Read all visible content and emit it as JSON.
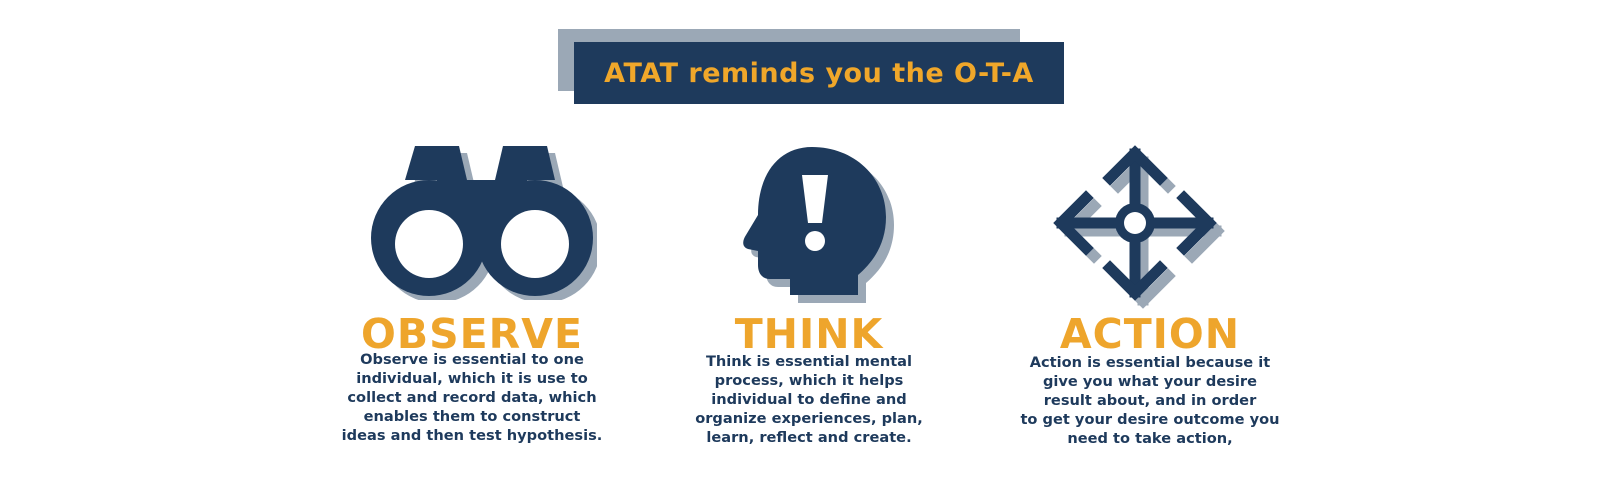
{
  "banner": {
    "title": "ATAT reminds you the O-T-A"
  },
  "colors": {
    "navy": "#1e3a5c",
    "gold": "#eea52c",
    "shadow": "#9ba8b6"
  },
  "columns": [
    {
      "icon": "binoculars-icon",
      "heading": "OBSERVE",
      "lines": [
        "Observe is essential to one",
        "individual, which it is use to",
        "collect and record data, which",
        "enables them to construct",
        "ideas and then test hypothesis."
      ]
    },
    {
      "icon": "head-exclamation-icon",
      "heading": "THINK",
      "lines": [
        "Think is essential mental",
        "process, which it helps",
        "individual to define and",
        "organize experiences, plan,",
        "learn, reflect and create."
      ]
    },
    {
      "icon": "four-way-arrows-icon",
      "heading": "ACTION",
      "lines": [
        "Action is essential because it",
        "give you what your desire",
        "result about, and in order",
        "to get your desire outcome you",
        "need to take action,"
      ]
    }
  ]
}
